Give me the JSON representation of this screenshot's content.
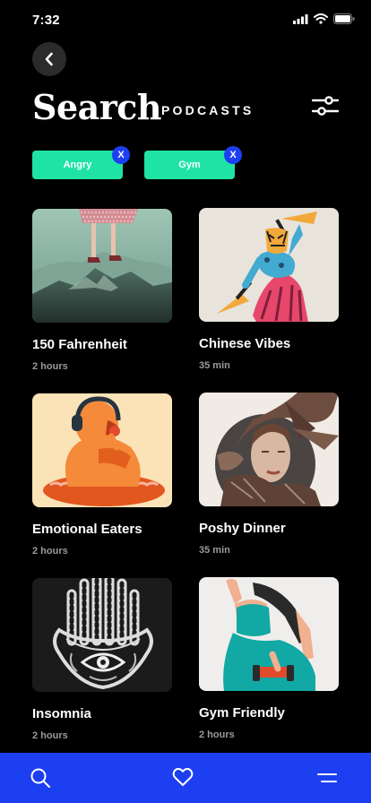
{
  "status": {
    "time": "7:32"
  },
  "header": {
    "title": "Search",
    "subtitle": "PODCASTS"
  },
  "filters": [
    {
      "label": "Angry",
      "close": "X"
    },
    {
      "label": "Gym",
      "close": "X"
    }
  ],
  "podcasts": [
    {
      "title": "150 Fahrenheit",
      "duration": "2 hours"
    },
    {
      "title": "Chinese Vibes",
      "duration": "35 min"
    },
    {
      "title": "Emotional Eaters",
      "duration": "2 hours"
    },
    {
      "title": "Poshy Dinner",
      "duration": "35 min"
    },
    {
      "title": "Insomnia",
      "duration": "2 hours"
    },
    {
      "title": "Gym Friendly",
      "duration": "2 hours"
    }
  ],
  "nav": {
    "items": [
      "search-icon",
      "heart-icon",
      "menu-icon"
    ]
  },
  "colors": {
    "background": "#000000",
    "chip": "#1ee3a4",
    "accent": "#1d3ff2",
    "muted_text": "#9a9a9a"
  }
}
